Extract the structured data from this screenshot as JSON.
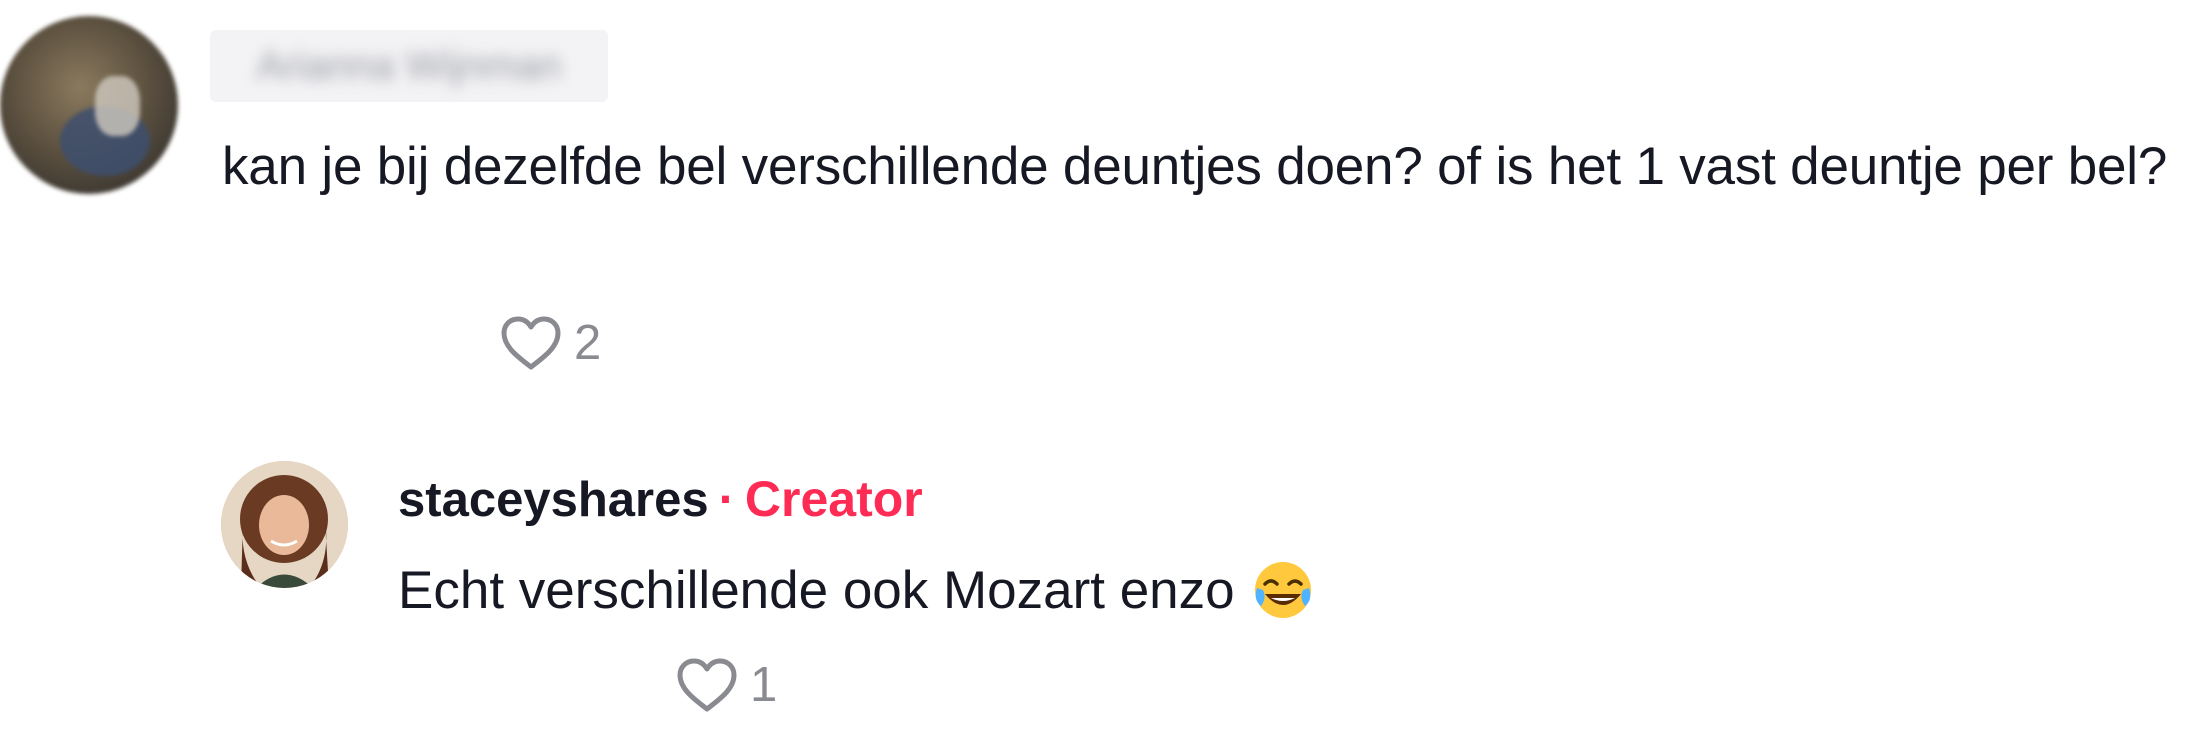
{
  "comment": {
    "author": "Arianna Wijnman",
    "text": "kan je bij dezelfde bel verschillende deuntjes doen? of is het 1 vast deuntje per bel?",
    "likes": "2"
  },
  "reply": {
    "username": "staceyshares",
    "separator": "·",
    "badge": "Creator",
    "text": "Echt verschillende ook Mozart enzo",
    "emoji": "face-with-tears-of-joy",
    "likes": "1"
  },
  "colors": {
    "text": "#161823",
    "muted": "#8a8b91",
    "creator_badge": "#fe2c55"
  }
}
